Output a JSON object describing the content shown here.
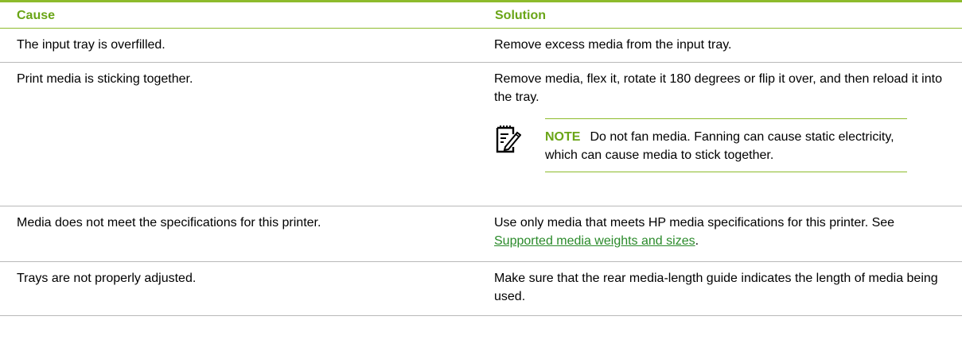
{
  "table": {
    "headers": {
      "cause": "Cause",
      "solution": "Solution"
    },
    "rows": [
      {
        "cause": "The input tray is overfilled.",
        "solution": "Remove excess media from the input tray."
      },
      {
        "cause": "Print media is sticking together.",
        "solution": "Remove media, flex it, rotate it 180 degrees or flip it over, and then reload it into the tray.",
        "note": {
          "label": "NOTE",
          "text": "Do not fan media. Fanning can cause static electricity, which can cause media to stick together.",
          "icon": "note-pencil-icon"
        }
      },
      {
        "cause": "Media does not meet the specifications for this printer.",
        "solution_before": "Use only media that meets HP media specifications for this printer. See ",
        "solution_link": "Supported media weights and sizes",
        "solution_after": "."
      },
      {
        "cause": "Trays are not properly adjusted.",
        "solution": "Make sure that the rear media-length guide indicates the length of media being used."
      }
    ]
  },
  "colors": {
    "accent": "#8dbb2c",
    "heading": "#6aa517",
    "rule": "#b9b9b9",
    "link": "#2a8a2a"
  }
}
